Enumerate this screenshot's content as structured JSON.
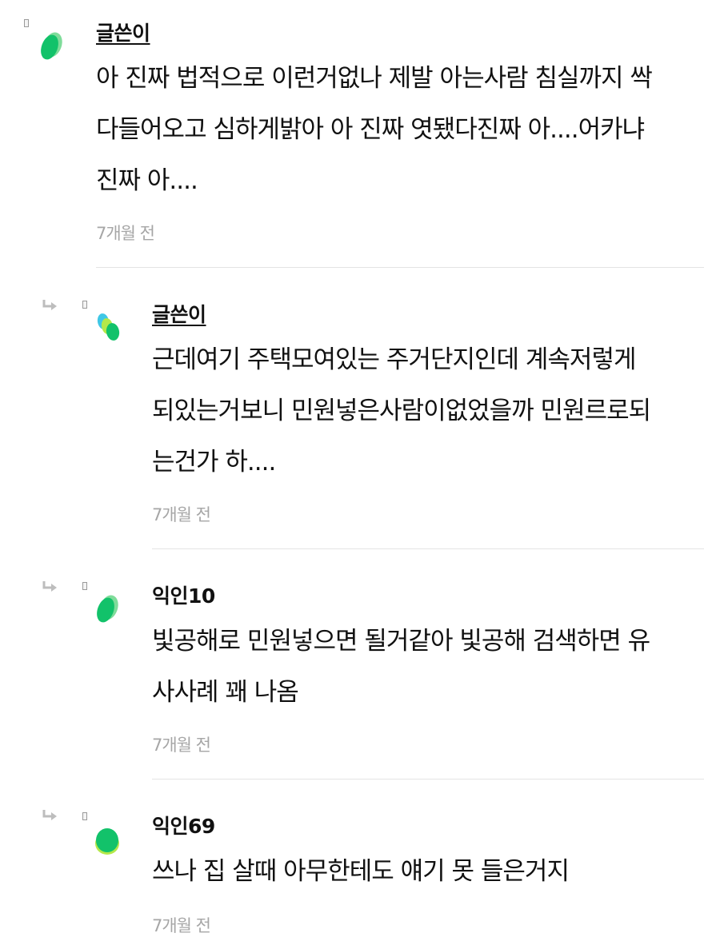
{
  "comments": [
    {
      "author": "글쓴이",
      "author_is_op": true,
      "lines": [
        "아 진짜 법적으로 이런거없나 제발 아는사람 침실까지 싹",
        "다들어오고 심하게밝아 아 진짜 엿됐다진짜 아....어카냐",
        "진짜 아...."
      ],
      "time": "7개월 전"
    },
    {
      "author": "글쓴이",
      "author_is_op": true,
      "lines": [
        "근데여기 주택모여있는 주거단지인데 계속저렇게",
        "되있는거보니 민원넣은사람이없었을까 민원르로되",
        "는건가 하...."
      ],
      "time": "7개월 전"
    },
    {
      "author": "익인10",
      "author_is_op": false,
      "lines": [
        "빛공해로 민원넣으면 될거같아 빛공해 검색하면 유",
        "사사례 꽤 나옴"
      ],
      "time": "7개월 전"
    },
    {
      "author": "익인69",
      "author_is_op": false,
      "lines": [
        "쓰나 집 살때 아무한테도 얘기 못 들은거지"
      ],
      "time": "7개월 전"
    }
  ],
  "icons": {
    "reply_arrow": "reply-arrow-icon",
    "avatar": "avatar-icon",
    "badge": "badge-square-icon"
  },
  "colors": {
    "avatar_green": "#12c26a",
    "avatar_light_green": "#7fdc9a",
    "avatar_cyan": "#3fc7e6",
    "avatar_lime": "#b4e84a",
    "timestamp": "#a6a6a6",
    "divider": "#e4e4e4"
  }
}
